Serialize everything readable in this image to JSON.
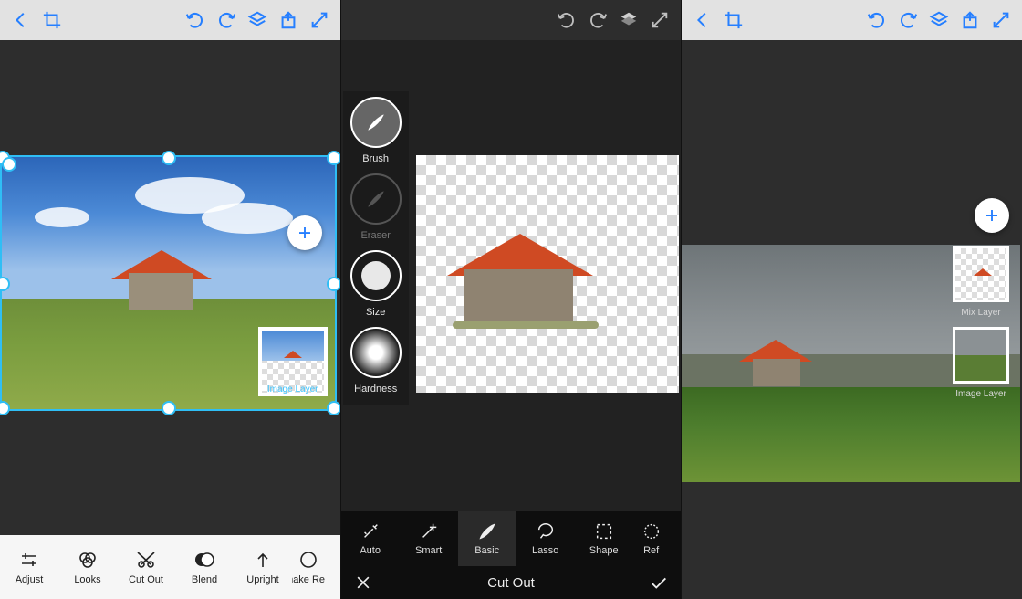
{
  "panel1": {
    "toolbar_top_icons": [
      "back",
      "crop",
      "undo",
      "redo",
      "layers",
      "share",
      "expand"
    ],
    "add_layer_label": "+",
    "thumb_label": "Image Layer",
    "bottom_tools": [
      {
        "label": "Adjust"
      },
      {
        "label": "Looks"
      },
      {
        "label": "Cut Out"
      },
      {
        "label": "Blend"
      },
      {
        "label": "Upright"
      },
      {
        "label": "Shake Redu"
      }
    ]
  },
  "panel2": {
    "toolbar_top_icons": [
      "undo",
      "redo",
      "layers",
      "expand"
    ],
    "side_tools": [
      {
        "label": "Brush"
      },
      {
        "label": "Eraser"
      },
      {
        "label": "Size"
      },
      {
        "label": "Hardness"
      }
    ],
    "bottom_tabs": [
      {
        "label": "Auto"
      },
      {
        "label": "Smart"
      },
      {
        "label": "Basic",
        "selected": true
      },
      {
        "label": "Lasso"
      },
      {
        "label": "Shape"
      },
      {
        "label": "Ref"
      }
    ],
    "title": "Cut Out",
    "cancel": "×",
    "confirm": "✓"
  },
  "panel3": {
    "toolbar_top_icons": [
      "back",
      "crop",
      "undo",
      "redo",
      "layers",
      "share",
      "expand"
    ],
    "layers": [
      {
        "label": "Mix Layer"
      },
      {
        "label": "Image Layer"
      }
    ]
  }
}
